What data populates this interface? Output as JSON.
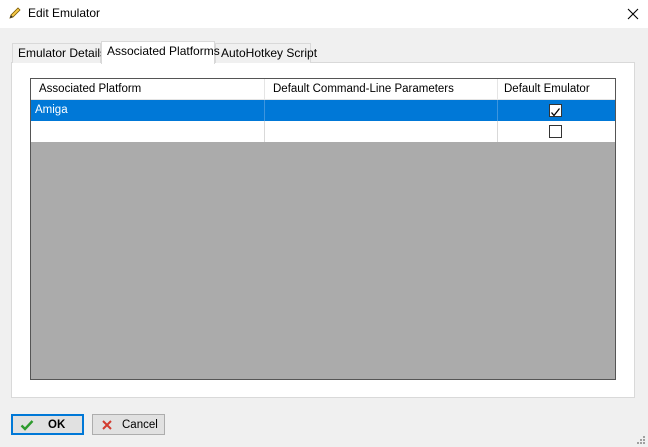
{
  "window": {
    "title": "Edit Emulator",
    "icon": "pencil-icon",
    "close_icon": "close-icon"
  },
  "tabs": [
    {
      "label": "Emulator Details",
      "active": false
    },
    {
      "label": "Associated Platforms",
      "active": true
    },
    {
      "label": "AutoHotkey Script",
      "active": false
    }
  ],
  "grid": {
    "columns": [
      "Associated Platform",
      "Default Command-Line Parameters",
      "Default Emulator"
    ],
    "rows": [
      {
        "platform": "Amiga",
        "params": "",
        "default_emulator": true,
        "selected": true
      },
      {
        "platform": "",
        "params": "",
        "default_emulator": false,
        "selected": false
      }
    ],
    "selection_color": "#0078d7",
    "empty_area_color": "#ababab"
  },
  "buttons": {
    "ok_label": "OK",
    "ok_icon": "checkmark-icon",
    "cancel_label": "Cancel",
    "cancel_icon": "x-icon"
  }
}
